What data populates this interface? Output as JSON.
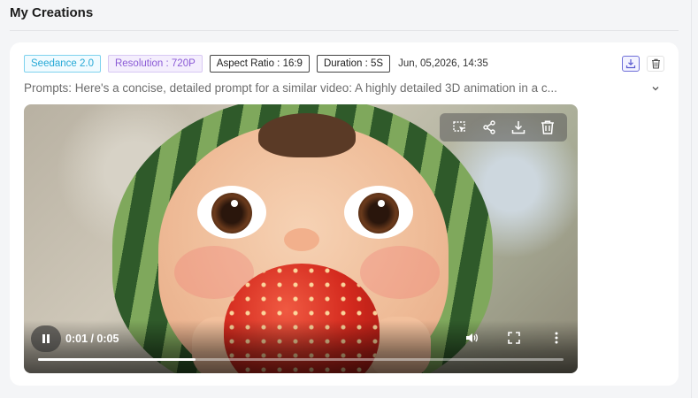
{
  "section": {
    "title": "My Creations"
  },
  "creation": {
    "tags": {
      "model": "Seedance 2.0",
      "resolution": "Resolution : 720P",
      "aspect_ratio": "Aspect Ratio : 16:9",
      "duration": "Duration : 5S"
    },
    "date": "Jun, 05,2026, 14:35",
    "prompt": "Prompts: Here's a concise, detailed prompt for a similar video: A highly detailed 3D animation in a c...",
    "actions": {
      "download_icon": "download-icon",
      "delete_icon": "trash-icon"
    },
    "video": {
      "toolbar": [
        "image-to-video-icon",
        "share-icon",
        "download-icon",
        "trash-icon"
      ],
      "time": "0:01 / 0:05",
      "progress": 0.3,
      "state": "playing"
    }
  },
  "colors": {
    "model_tag": "#27a9d6",
    "resolution_tag": "#8b5bd6",
    "download_accent": "#6f6fd8"
  }
}
